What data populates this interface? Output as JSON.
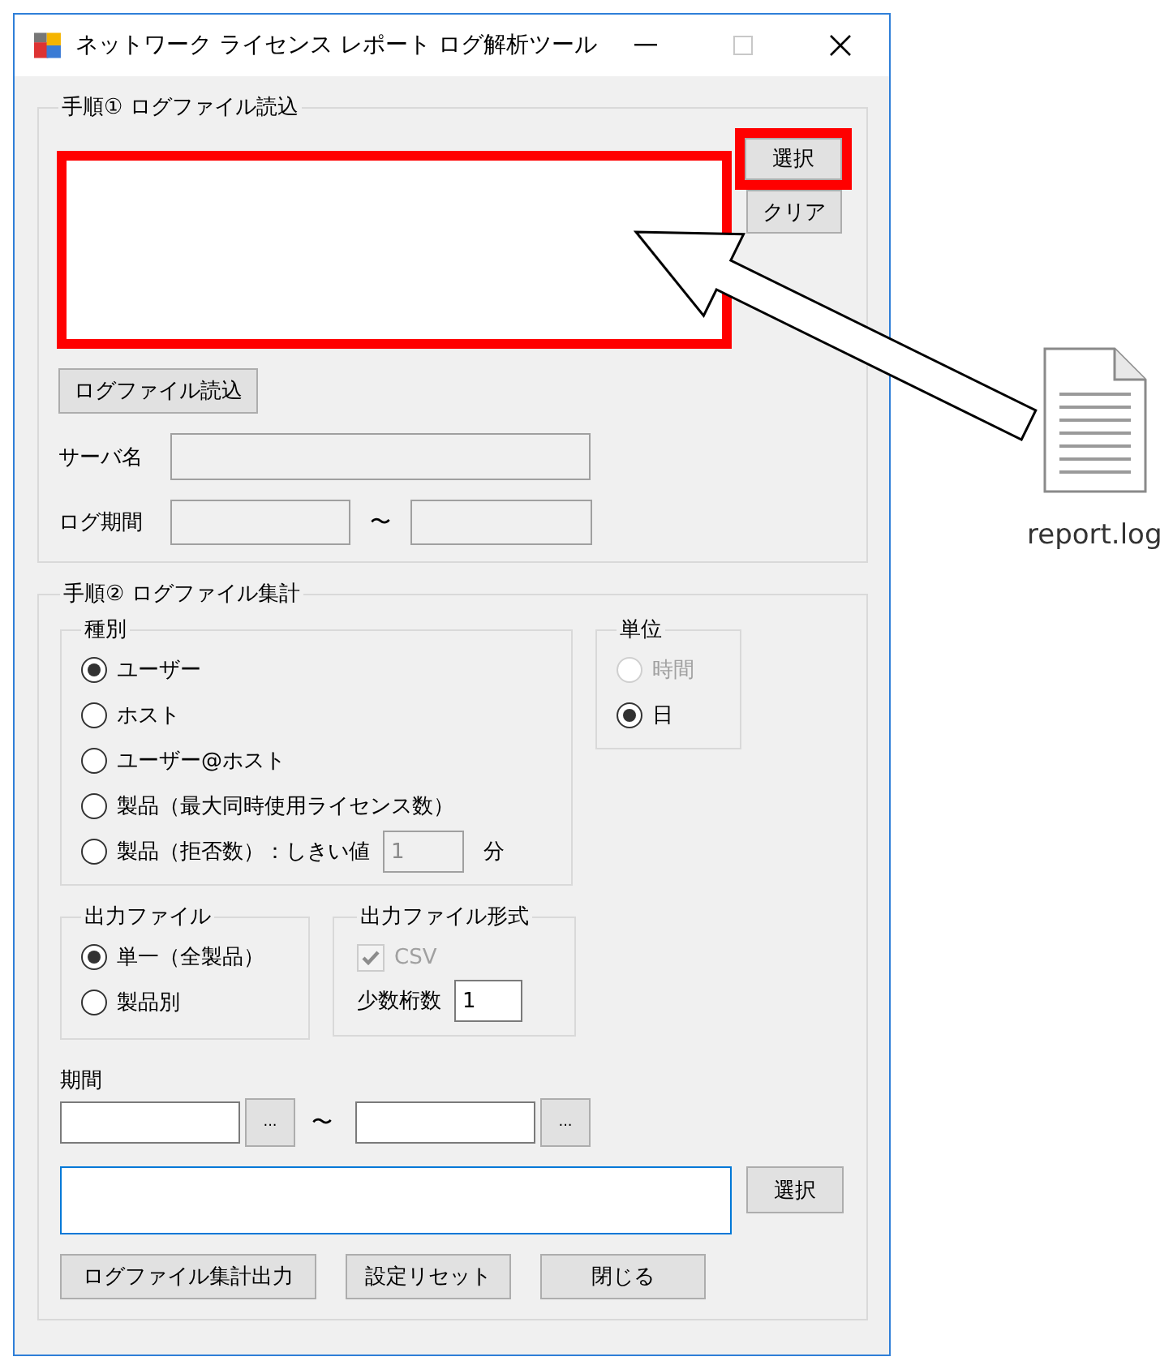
{
  "window": {
    "title": "ネットワーク ライセンス レポート ログ解析ツール",
    "maximize_disabled": true
  },
  "step1": {
    "legend": "手順① ログファイル読込",
    "file_list": {
      "highlighted": true
    },
    "select_button": {
      "label": "選択",
      "highlighted": true
    },
    "clear_button": {
      "label": "クリア"
    },
    "load_button": {
      "label": "ログファイル読込"
    },
    "server_name": {
      "label": "サーバ名",
      "disabled": true
    },
    "log_period": {
      "label": "ログ期間",
      "separator": "〜",
      "disabled": true
    }
  },
  "step2": {
    "legend": "手順② ログファイル集計",
    "type_group": {
      "legend": "種別",
      "options": [
        {
          "label": "ユーザー",
          "selected": true
        },
        {
          "label": "ホスト",
          "selected": false
        },
        {
          "label": "ユーザー@ホスト",
          "selected": false
        },
        {
          "label": "製品（最大同時使用ライセンス数）",
          "selected": false
        },
        {
          "label": "製品（拒否数）：しきい値",
          "selected": false
        }
      ],
      "threshold": {
        "value": "1",
        "disabled": true,
        "unit": "分"
      }
    },
    "unit_group": {
      "legend": "単位",
      "options": [
        {
          "label": "時間",
          "selected": false,
          "disabled": true
        },
        {
          "label": "日",
          "selected": true,
          "disabled": false
        }
      ]
    },
    "output_group": {
      "legend": "出力ファイル",
      "options": [
        {
          "label": "単一（全製品）",
          "selected": true
        },
        {
          "label": "製品別",
          "selected": false
        }
      ]
    },
    "format_group": {
      "legend": "出力ファイル形式",
      "csv": {
        "label": "CSV",
        "checked": true,
        "disabled": true
      },
      "decimals": {
        "label": "少数桁数",
        "value": "1"
      }
    },
    "period": {
      "label": "期間",
      "separator": "〜",
      "picker_label": "..."
    },
    "output_path": {
      "focused": true
    },
    "select_button": {
      "label": "選択"
    },
    "buttons": [
      {
        "label": "ログファイル集計出力"
      },
      {
        "label": "設定リセット"
      },
      {
        "label": "閉じる"
      }
    ]
  },
  "desktop_file": {
    "name": "report.log"
  }
}
